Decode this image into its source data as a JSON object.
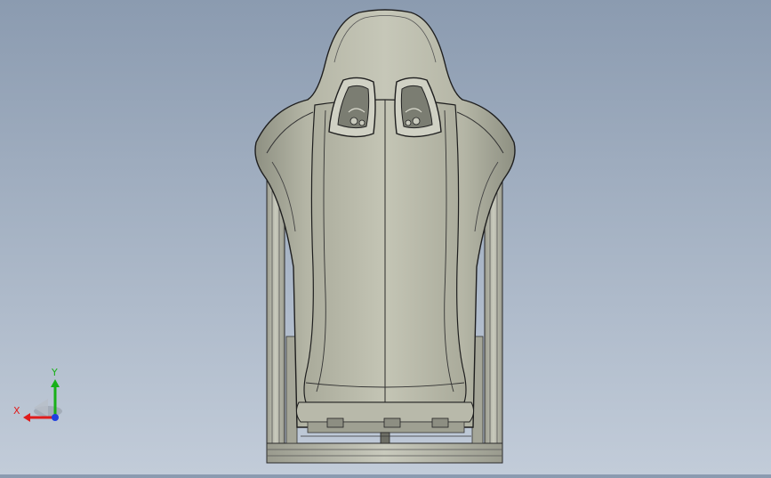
{
  "viewport": {
    "model_name": "racing-seat",
    "background_top": "#8b9bb0",
    "background_bottom": "#c2ccd9"
  },
  "triad": {
    "x_label": "X",
    "y_label": "Y",
    "x_color": "#e01c1c",
    "y_color": "#18b018",
    "z_color": "#2040e0"
  }
}
